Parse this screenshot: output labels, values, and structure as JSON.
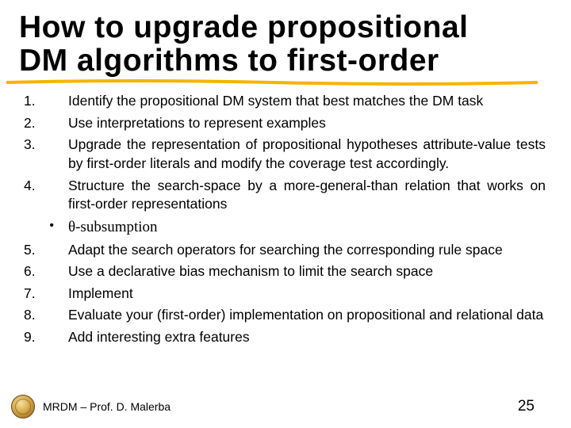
{
  "title_line1": "How to upgrade propositional",
  "title_line2": "DM algorithms to first-order",
  "items": {
    "n1": "1.",
    "t1": "Identify the propositional DM system that best matches the DM task",
    "n2": "2.",
    "t2": "Use interpretations to represent examples",
    "n3": "3.",
    "t3": "Upgrade the representation of propositional hypotheses attribute-value tests by first-order literals and modify the coverage test accordingly.",
    "n4": "4.",
    "t4": "Structure the search-space by a more-general-than relation that works on first-order representations",
    "sub_bullet": "•",
    "sub_text": "θ-subsumption",
    "n5": "5.",
    "t5": "Adapt the search operators for searching the corresponding rule space",
    "n6": "6.",
    "t6": "Use a declarative bias mechanism to limit the search space",
    "n7": "7.",
    "t7": "Implement",
    "n8": "8.",
    "t8": "Evaluate your (first-order) implementation on propositional and relational data",
    "n9": "9.",
    "t9": "Add interesting extra features"
  },
  "footer": {
    "text": "MRDM – Prof. D. Malerba",
    "page": "25"
  }
}
